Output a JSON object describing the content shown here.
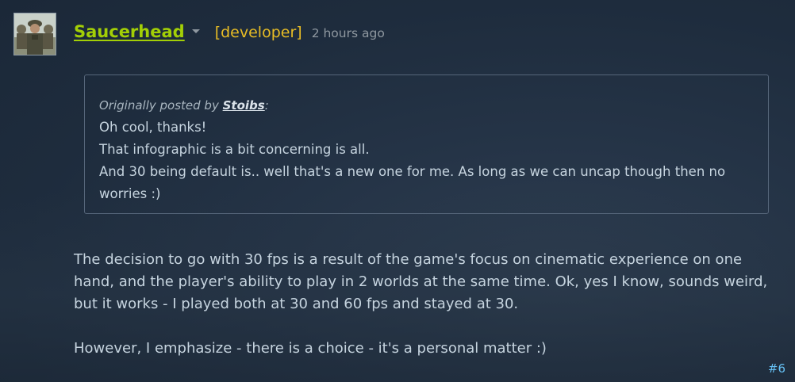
{
  "post": {
    "author": "Saucerhead",
    "role": "[developer]",
    "timestamp": "2 hours ago",
    "post_number": "#6"
  },
  "quote": {
    "attribution_prefix": "Originally posted by",
    "author": "Stoibs",
    "attribution_suffix": ":",
    "lines": [
      "Oh cool, thanks!",
      "That infographic is a bit concerning is all.",
      "And 30 being default is.. well that's a new one for me. As long as we can uncap though then no worries :)"
    ]
  },
  "body": {
    "paragraph_1": "The decision to go with 30 fps is a result of the game's focus on cinematic experience on one hand, and the player's ability to play in 2 worlds at the same time. Ok, yes I know, sounds weird, but it works - I played both at 30 and 60 fps and stayed at 30.",
    "paragraph_2": "However, I emphasize - there is a choice - it's a personal matter :)"
  },
  "colors": {
    "author": "#a3cf06",
    "role": "#e8bd25",
    "link": "#66c0f4",
    "background": "#1b2838"
  },
  "icons": {
    "avatar": "soldier-avatar",
    "dropdown": "chevron-down-icon"
  }
}
